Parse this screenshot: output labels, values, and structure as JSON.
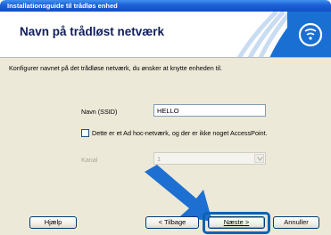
{
  "window": {
    "title": "Installationsguide til trådløs enhed"
  },
  "banner": {
    "heading": "Navn på trådløst netværk"
  },
  "form": {
    "description": "Konfigurer navnet på det trådløse netværk, du ønsker at knytte enheden til.",
    "ssid_label": "Navn (SSID)",
    "ssid_value": "HELLO",
    "adhoc_checkbox_label": "Dette er et Ad hoc-netværk, og der er ikke noget AccessPoint.",
    "adhoc_checked": false,
    "channel_label": "Kanal",
    "channel_value": "1"
  },
  "buttons": {
    "help": "Hjælp",
    "back": "< Tilbage",
    "next": "Næste >",
    "cancel": "Annuller"
  },
  "icons": [
    "wireless-logo-icon",
    "dropdown-arrow-icon",
    "pointer-arrow-icon"
  ],
  "colors": {
    "titlebar": "#1c5fd7",
    "heading": "#0e1e5c",
    "highlight": "#0a63b3",
    "arrow": "#1d6fd1"
  }
}
